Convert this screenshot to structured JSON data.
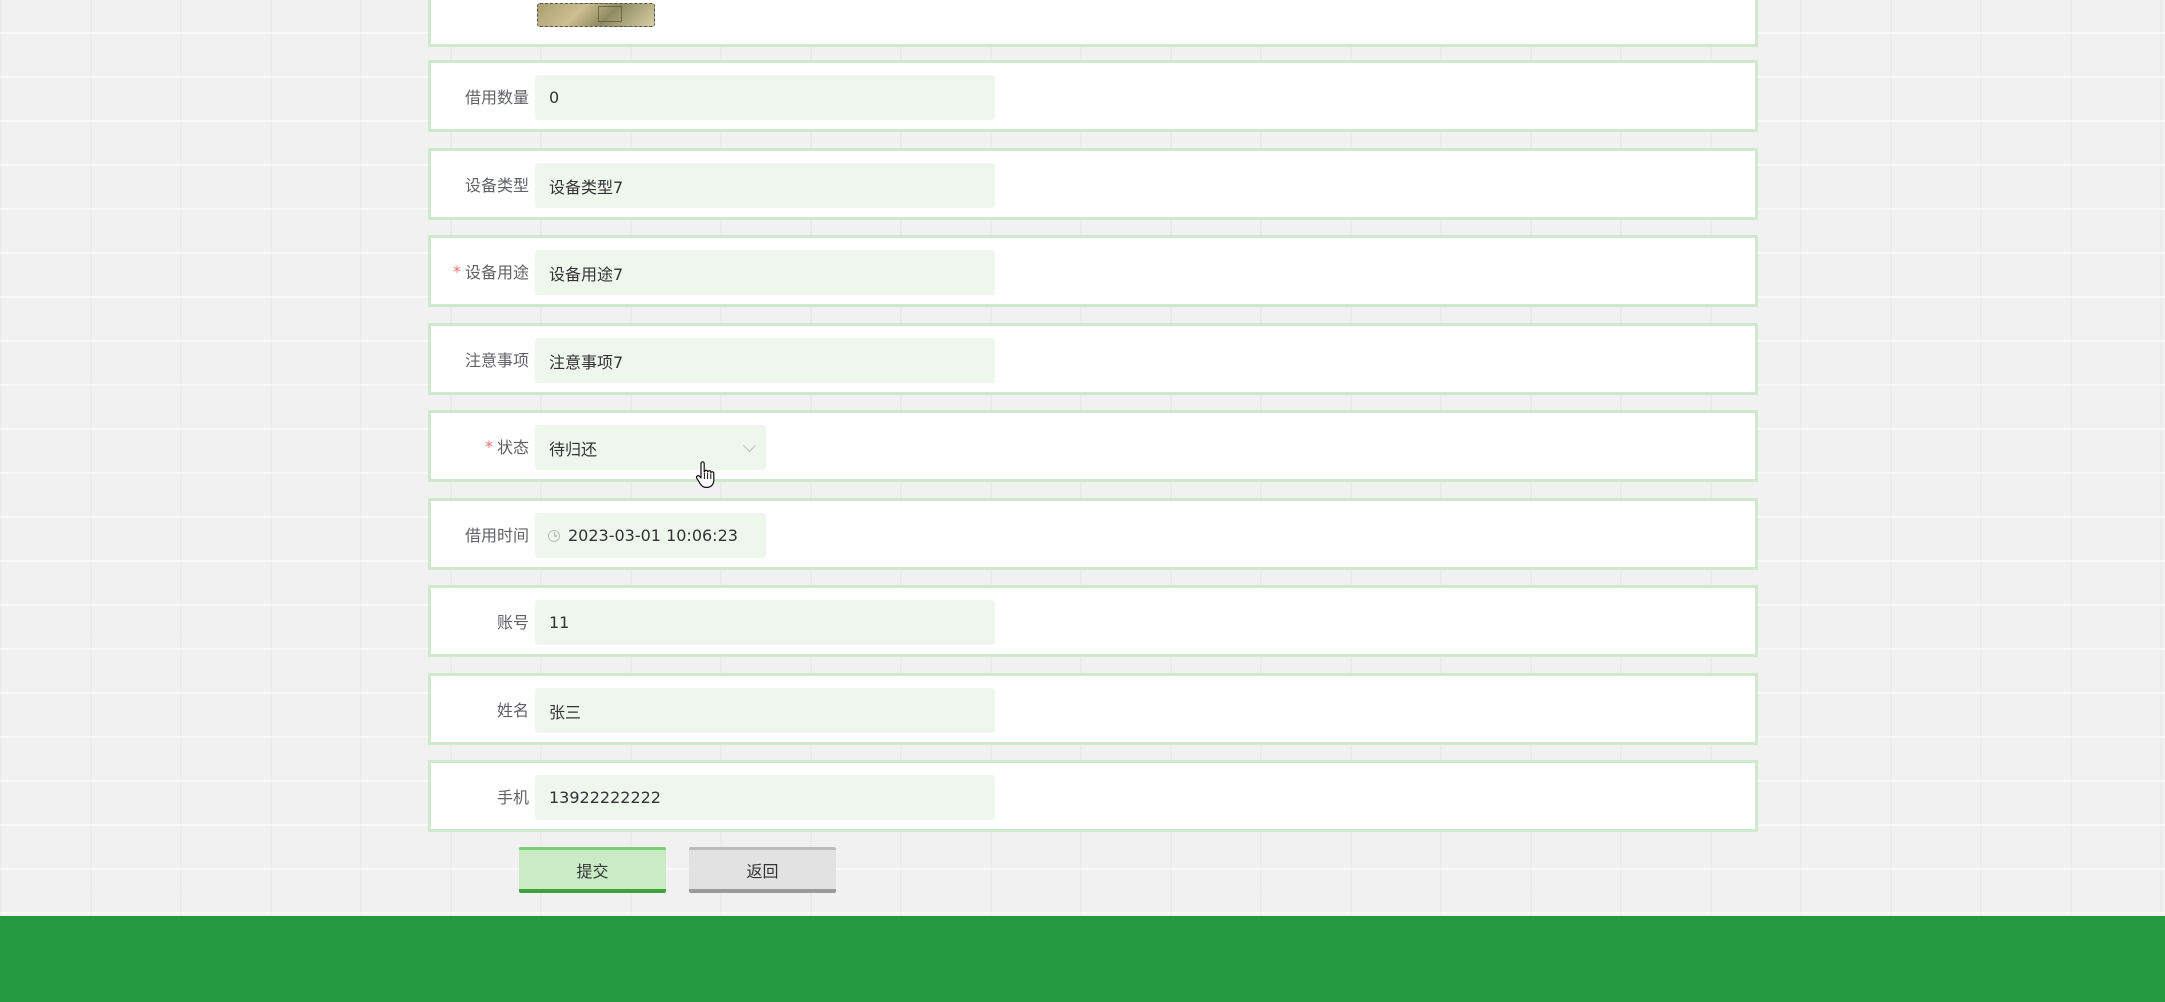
{
  "form": {
    "rows": [
      {
        "label": "借用数量",
        "value": "0",
        "required": false
      },
      {
        "label": "设备类型",
        "value": "设备类型7",
        "required": false
      },
      {
        "label": "设备用途",
        "value": "设备用途7",
        "required": true
      },
      {
        "label": "注意事项",
        "value": "注意事项7",
        "required": false
      },
      {
        "label": "状态",
        "value": "待归还",
        "required": true,
        "type": "select"
      },
      {
        "label": "借用时间",
        "value": "2023-03-01 10:06:23",
        "required": false,
        "type": "datetime"
      },
      {
        "label": "账号",
        "value": "11",
        "required": false
      },
      {
        "label": "姓名",
        "value": "张三",
        "required": false
      },
      {
        "label": "手机",
        "value": "13922222222",
        "required": false
      }
    ],
    "required_mark": "*"
  },
  "buttons": {
    "submit_label": "提交",
    "back_label": "返回"
  },
  "icons": {
    "select_arrow": "chevron-down-icon",
    "datetime": "clock-icon",
    "pointer": "hand-cursor-icon"
  },
  "colors": {
    "row_border": "#cfe9cd",
    "input_bg": "#eef6ee",
    "required": "#f56c6c",
    "submit_bg": "#c9ecc5",
    "submit_accent": "#3ea13a",
    "back_bg": "#e2e2e2",
    "footer_bg": "#259a3f"
  }
}
